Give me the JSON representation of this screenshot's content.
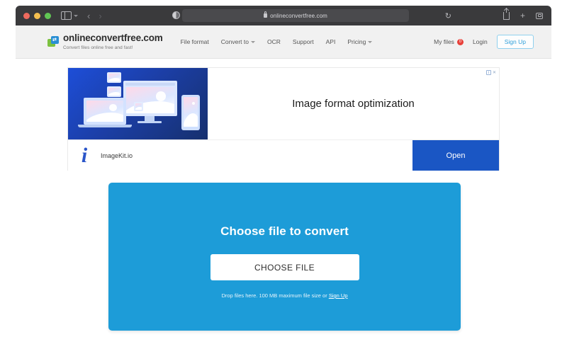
{
  "browser": {
    "url": "onlineconvertfree.com",
    "lock_icon": "lock-icon",
    "reload_icon": "↻",
    "back_icon": "‹",
    "forward_icon": "›",
    "share_icon": "share-icon",
    "new_tab_icon": "+",
    "tabs_icon": "tabs-overview-icon",
    "reader_icon": "reader-view-icon",
    "sidebar_icon": "sidebar-toggle-icon"
  },
  "site_header": {
    "logo_text": "onlineconvertfree.com",
    "logo_tagline": "Convert files online free and fast!",
    "nav": [
      {
        "label": "File format",
        "caret": false
      },
      {
        "label": "Convert to",
        "caret": true
      },
      {
        "label": "OCR",
        "caret": false
      },
      {
        "label": "Support",
        "caret": false
      },
      {
        "label": "API",
        "caret": false
      },
      {
        "label": "Pricing",
        "caret": true
      }
    ],
    "my_files_label": "My files",
    "my_files_badge": "0",
    "login_label": "Login",
    "signup_label": "Sign Up"
  },
  "ad": {
    "headline": "Image format optimization",
    "advertiser": "ImageKit.io",
    "cta_label": "Open",
    "adchoices_label": "i",
    "close_label": "✕",
    "brand_letter": "i"
  },
  "hero": {
    "title": "Choose file to convert",
    "button_label": "CHOOSE FILE",
    "drop_text_prefix": "Drop files here. 100 MB maximum file size or ",
    "drop_text_link": "Sign Up"
  },
  "colors": {
    "hero_blue": "#1d9cd8",
    "ad_button_blue": "#1a56c4",
    "badge_red": "#e8413a",
    "signup_blue": "#2f9fd9",
    "header_gray": "#f1f1f1",
    "chrome_dark": "#3a3a3c"
  }
}
